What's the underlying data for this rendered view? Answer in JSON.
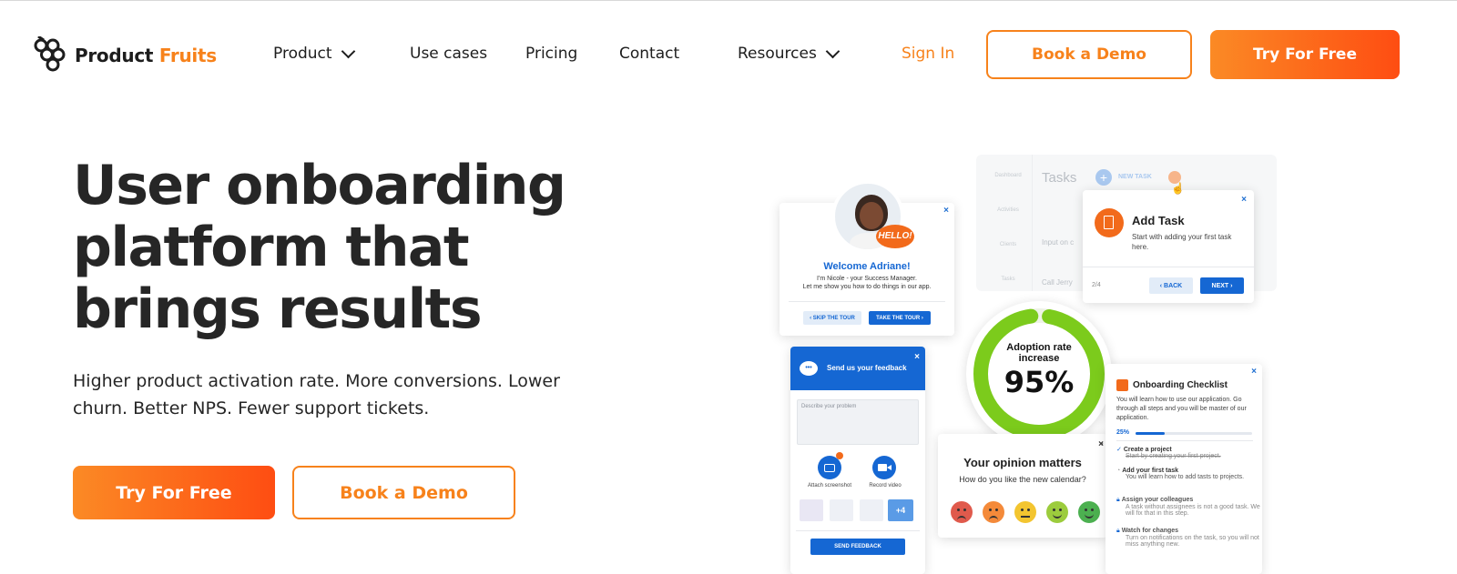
{
  "nav": {
    "logo_primary": "Product",
    "logo_accent": "Fruits",
    "items": [
      {
        "label": "Product",
        "has_dropdown": true
      },
      {
        "label": "Use cases",
        "has_dropdown": false
      },
      {
        "label": "Pricing",
        "has_dropdown": false
      },
      {
        "label": "Contact",
        "has_dropdown": false
      },
      {
        "label": "Resources",
        "has_dropdown": true
      }
    ],
    "sign_in": "Sign In",
    "book_demo": "Book a Demo",
    "try_free": "Try For Free"
  },
  "hero": {
    "title_lines": [
      "User onboarding",
      "platform that",
      "brings results"
    ],
    "subtitle": "Higher product activation rate. More conversions. Lower churn. Better NPS. Fewer support tickets.",
    "cta_primary": "Try For Free",
    "cta_secondary": "Book a Demo"
  },
  "colors": {
    "accent": "#f7821b",
    "accent_end": "#fe4d12",
    "blue": "#1567d3",
    "green": "#7ccb1c"
  },
  "mockups": {
    "welcome": {
      "badge": "HELLO!",
      "title": "Welcome Adriane!",
      "body_1": "I'm Nicole - your Success Manager.",
      "body_2": "Let me show you how to do things in our app.",
      "skip": "SKIP THE TOUR",
      "take": "TAKE THE TOUR"
    },
    "tasks": {
      "title": "Tasks",
      "new_task": "NEW TASK",
      "sidebar": [
        "Dashboard",
        "Activities",
        "Clients",
        "Tasks"
      ],
      "rows": [
        "Input on c",
        "Call Jerry"
      ],
      "popup_title": "Add Task",
      "popup_body": "Start with adding your first task here.",
      "step": "2/4",
      "back": "BACK",
      "next": "NEXT"
    },
    "adoption": {
      "label_1": "Adoption rate",
      "label_2": "increase",
      "value": "95%",
      "percent": 95
    },
    "feedback": {
      "title": "Send us your feedback",
      "placeholder": "Describe your problem",
      "attach": "Attach screenshot",
      "record": "Record video",
      "more": "+4",
      "send": "SEND FEEDBACK"
    },
    "opinion": {
      "title": "Your opinion matters",
      "question": "How do you like the new calendar?",
      "faces": [
        "#e05a4c",
        "#f48a3a",
        "#f3c530",
        "#9ccc3d",
        "#4cb050"
      ]
    },
    "checklist": {
      "title": "Onboarding Checklist",
      "intro": "You will learn how to use our application. Go through all steps and you will be master of our application.",
      "progress_label": "25%",
      "progress": 25,
      "items": [
        {
          "title": "Create a project",
          "desc": "Start by creating your first project.",
          "state": "done"
        },
        {
          "title": "Add your first task",
          "desc": "You will learn how to add tasts to projects.",
          "state": "in-progress"
        },
        {
          "title": "Assign your colleagues",
          "desc": "A task without assignees is not a good task. We will fix that in this step.",
          "state": "locked"
        },
        {
          "title": "Watch for changes",
          "desc": "Turn on notifications on the task, so you will not miss anything new.",
          "state": "locked"
        }
      ]
    }
  }
}
